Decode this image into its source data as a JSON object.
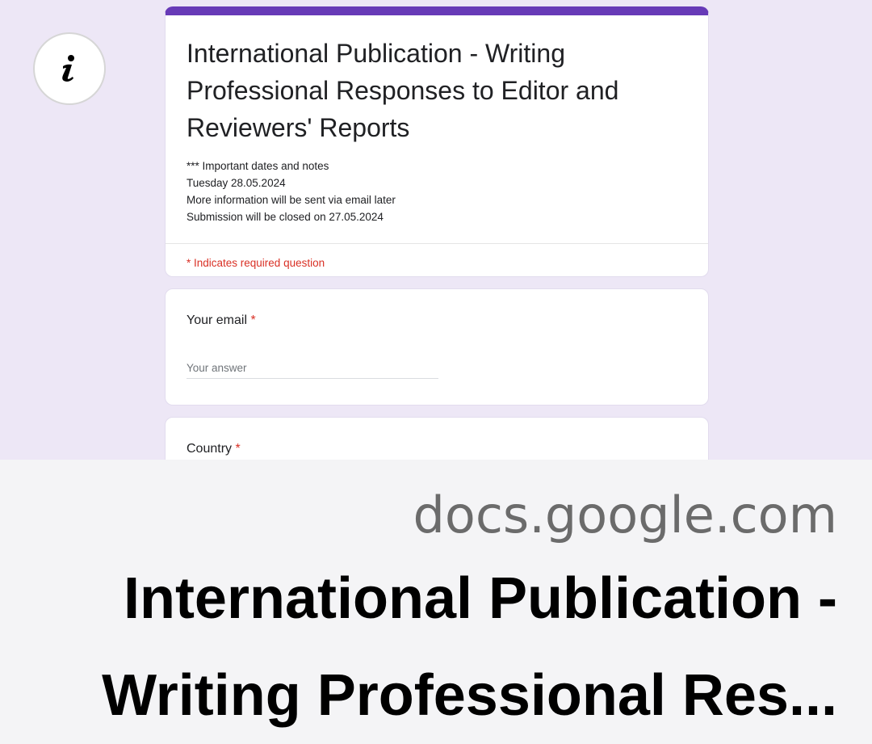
{
  "form": {
    "title": "International Publication - Writing Professional Responses to Editor and Reviewers' Reports",
    "description_lines": [
      "*** Important dates and notes",
      "Tuesday 28.05.2024",
      "More information will be sent via email later",
      "Submission will be closed on 27.05.2024"
    ],
    "required_note": "* Indicates required question",
    "questions": [
      {
        "label": "Your email",
        "required_mark": "*",
        "placeholder": "Your answer"
      },
      {
        "label": "Country",
        "required_mark": "*"
      }
    ],
    "accent_color": "#673ab7",
    "background_color": "#ede7f6"
  },
  "info_button": {
    "icon": "info-icon"
  },
  "link_preview": {
    "domain": "docs.google.com",
    "headline_line1": "International Publication -",
    "headline_line2": "Writing Professional Res..."
  }
}
